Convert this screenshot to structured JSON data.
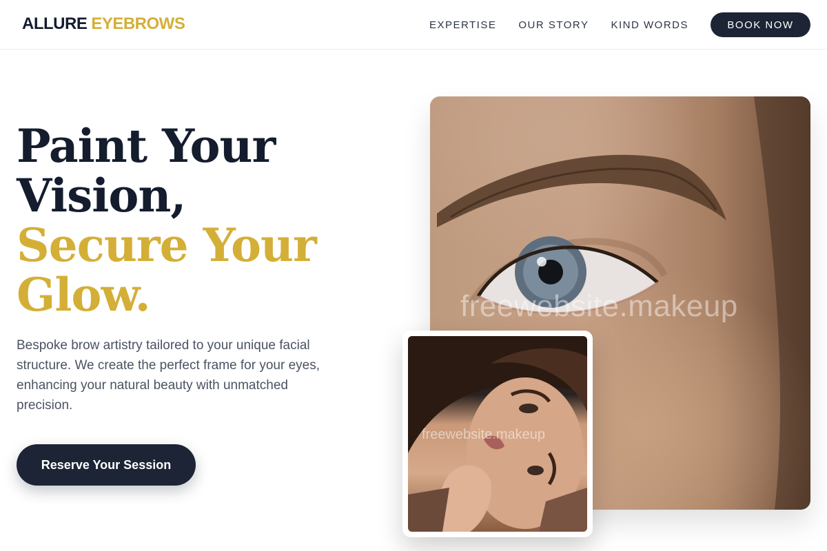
{
  "brand": {
    "part1": "ALLURE",
    "part2": "EYEBROWS"
  },
  "nav": {
    "links": [
      "EXPERTISE",
      "OUR STORY",
      "KIND WORDS"
    ],
    "book_label": "BOOK NOW"
  },
  "hero": {
    "title_lines": [
      "Paint Your",
      "Vision,",
      "Secure Your",
      "Glow."
    ],
    "description": "Bespoke brow artistry tailored to your unique facial structure. We create the perfect frame for your eyes, enhancing your natural beauty with unmatched precision.",
    "cta_label": "Reserve Your Session"
  },
  "images": {
    "large": {
      "subject": "close-up eye and eyebrow photo",
      "watermark": "freewebsite.makeup"
    },
    "small": {
      "subject": "woman portrait photo",
      "watermark": "freewebsite.makeup"
    }
  },
  "colors": {
    "navy": "#1c2436",
    "gold": "#d4af37",
    "text": "#4a5263"
  }
}
